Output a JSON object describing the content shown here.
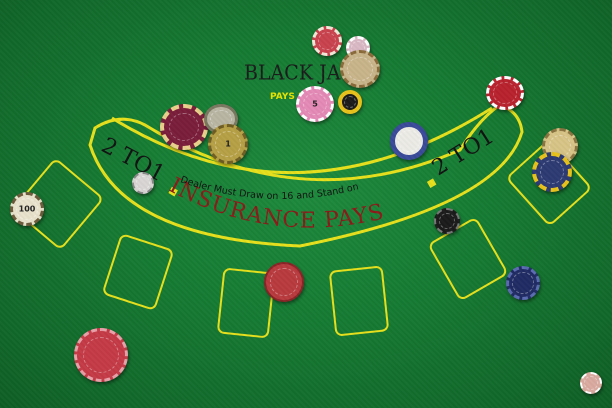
{
  "table": {
    "title": "BLACK JACK",
    "pays_prefix": "PAYS 3",
    "insurance_label": "INSURANCE PAYS",
    "payout_left": "2 TO1",
    "payout_right": "2 TO1",
    "dealer_rule": "Dealer Must Draw on 16 and Stand on",
    "felt_color": "#157a32",
    "line_color": "#e6e01c",
    "insurance_text_color": "#8b1a1a"
  },
  "chips": [
    {
      "name": "chip-red-top",
      "color": "#c9424d",
      "label": ""
    },
    {
      "name": "chip-pink-top",
      "color": "#d9b8c4",
      "label": ""
    },
    {
      "name": "chip-tan-top",
      "color": "#c9b48a",
      "label": ""
    },
    {
      "name": "chip-pink-5",
      "color": "#e48ab6",
      "label": "5"
    },
    {
      "name": "chip-yellow-black",
      "color": "#e8c21a",
      "label": ""
    },
    {
      "name": "chip-maroon",
      "color": "#7a1d3a",
      "label": ""
    },
    {
      "name": "chip-grey",
      "color": "#b8b6a2",
      "label": ""
    },
    {
      "name": "chip-brass",
      "color": "#b6a045",
      "label": "1"
    },
    {
      "name": "chip-red-right",
      "color": "#b8222d",
      "label": ""
    },
    {
      "name": "chip-white-blue",
      "color": "#ecebe6",
      "label": ""
    },
    {
      "name": "chip-cream-right",
      "color": "#d7c486",
      "label": ""
    },
    {
      "name": "chip-navy-yellow",
      "color": "#2c3a73",
      "label": ""
    },
    {
      "name": "chip-cream-100",
      "color": "#e8e2cc",
      "label": "100"
    },
    {
      "name": "chip-silver-small",
      "color": "#d9d5d5",
      "label": ""
    },
    {
      "name": "chip-black-small",
      "color": "#1a1a1a",
      "label": ""
    },
    {
      "name": "chip-red-center",
      "color": "#b83a3e",
      "label": ""
    },
    {
      "name": "chip-navy",
      "color": "#1f2b63",
      "label": ""
    },
    {
      "name": "chip-red-large",
      "color": "#c43a46",
      "label": ""
    },
    {
      "name": "chip-mini-corner",
      "color": "#d9aaa0",
      "label": ""
    }
  ]
}
